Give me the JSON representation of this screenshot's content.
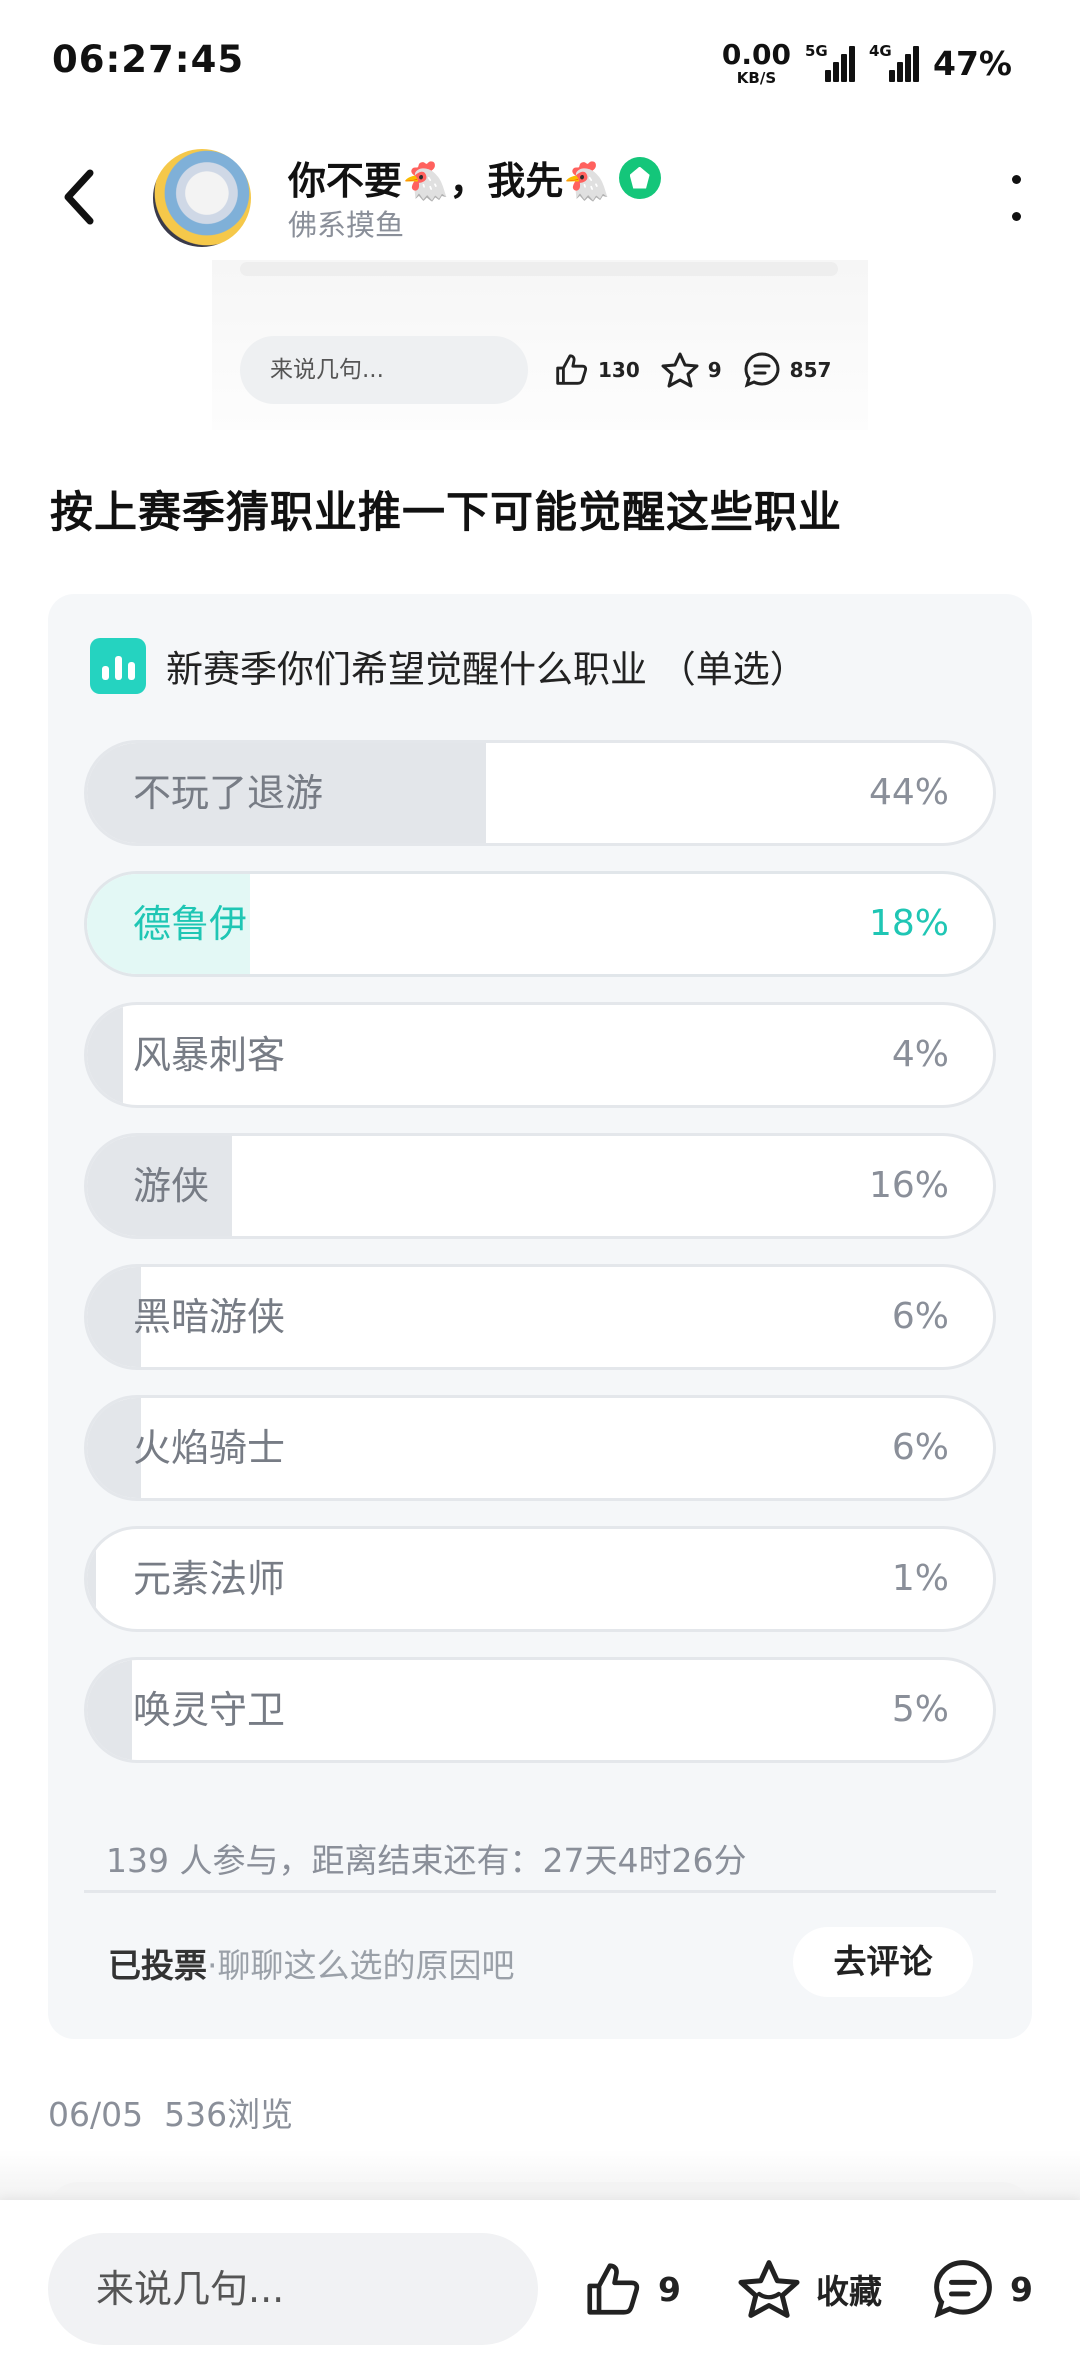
{
  "status_bar": {
    "time": "06:27:45",
    "net_speed_value": "0.00",
    "net_speed_unit": "KB/S",
    "sim1_tag": "5G",
    "sim2_tag": "4G",
    "battery": "47%"
  },
  "header": {
    "author_name": "你不要🐔，我先🐔",
    "author_subtitle": "佛系摸鱼"
  },
  "mini_bar": {
    "input_placeholder": "来说几句...",
    "likes": "130",
    "favorites": "9",
    "comments": "857"
  },
  "post": {
    "title": "按上赛季猜职业推一下可能觉醒这些职业",
    "date": "06/05",
    "views": "536浏览"
  },
  "poll": {
    "title": "新赛季你们希望觉醒什么职业 （单选）",
    "options": [
      {
        "label": "不玩了退游",
        "pct_text": "44%",
        "value": 44,
        "selected": false
      },
      {
        "label": "德鲁伊",
        "pct_text": "18%",
        "value": 18,
        "selected": true
      },
      {
        "label": "风暴刺客",
        "pct_text": "4%",
        "value": 4,
        "selected": false
      },
      {
        "label": "游侠",
        "pct_text": "16%",
        "value": 16,
        "selected": false
      },
      {
        "label": "黑暗游侠",
        "pct_text": "6%",
        "value": 6,
        "selected": false
      },
      {
        "label": "火焰骑士",
        "pct_text": "6%",
        "value": 6,
        "selected": false
      },
      {
        "label": "元素法师",
        "pct_text": "1%",
        "value": 1,
        "selected": false
      },
      {
        "label": "唤灵守卫",
        "pct_text": "5%",
        "value": 5,
        "selected": false
      }
    ],
    "meta": "139 人参与，距离结束还有：27天4时26分",
    "voted_label": "已投票",
    "voted_hint": "·聊聊这么选的原因吧",
    "go_comment": "去评论"
  },
  "bottom_bar": {
    "input_placeholder": "来说几句...",
    "likes": "9",
    "favorite_label": "收藏",
    "comments": "9"
  },
  "colors": {
    "accent": "#1fc6b4",
    "badge": "#14c67a",
    "card_bg": "#f5f7f9"
  }
}
